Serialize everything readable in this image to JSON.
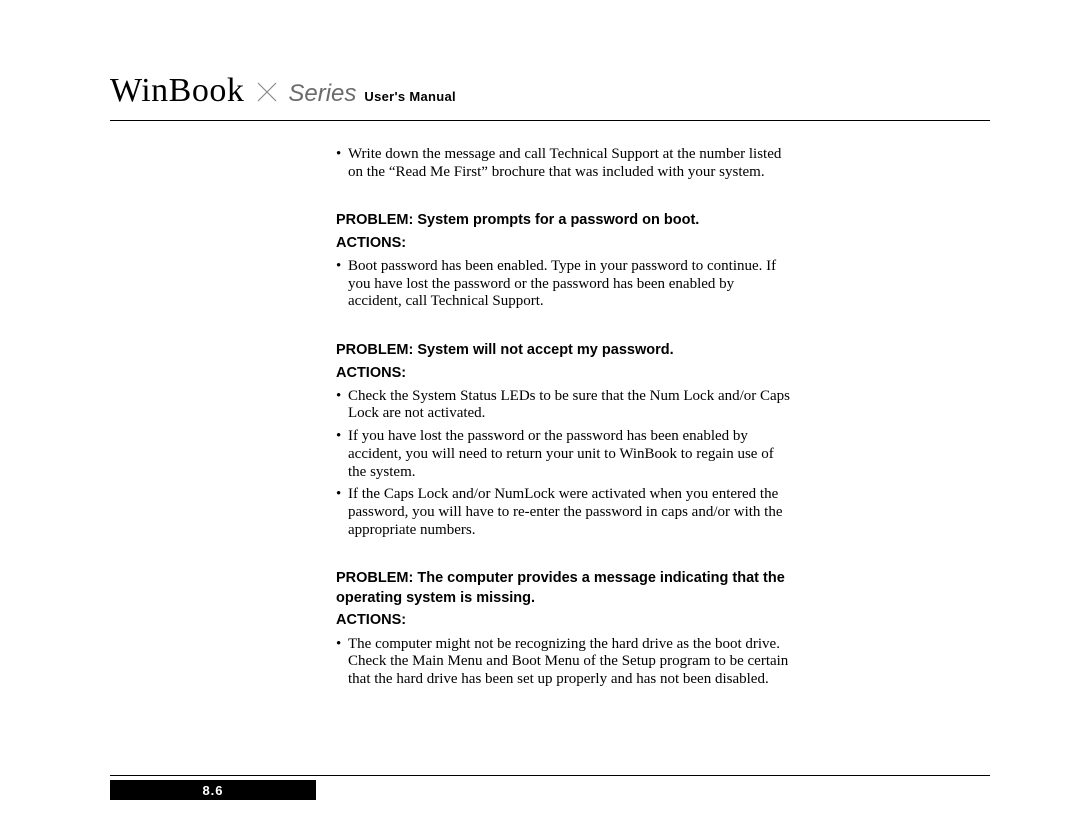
{
  "header": {
    "brand": "WinBook",
    "series": "Series",
    "manual": "User's Manual"
  },
  "intro_bullets": [
    "Write down the message and call Technical Support at the number listed on the “Read Me First” brochure that was included with your system."
  ],
  "sections": [
    {
      "problem": "PROBLEM: System prompts for a password on boot.",
      "actions_label": "ACTIONS:",
      "bullets": [
        "Boot password has been enabled. Type in your password to continue. If you have lost the password or the password has been enabled by accident, call Technical Support."
      ]
    },
    {
      "problem": "PROBLEM: System will not accept my password.",
      "actions_label": "ACTIONS:",
      "bullets": [
        "Check the System Status LEDs to be sure that the Num Lock and/or Caps Lock are not activated.",
        "If you have lost the password or the password has been enabled by accident, you will need to return your unit to WinBook to regain use of the system.",
        "If the Caps Lock and/or NumLock were activated when you entered the password, you will have to re-enter the password in caps and/or with the appropriate numbers."
      ]
    },
    {
      "problem": "PROBLEM: The computer provides a message indicating that the operating system is missing.",
      "actions_label": "ACTIONS:",
      "bullets": [
        "The computer might not be recognizing the hard drive as the boot drive. Check the Main Menu and Boot Menu of the Setup program to be certain that the hard drive has been set up properly and has not been disabled."
      ]
    }
  ],
  "page_number": "8.6"
}
